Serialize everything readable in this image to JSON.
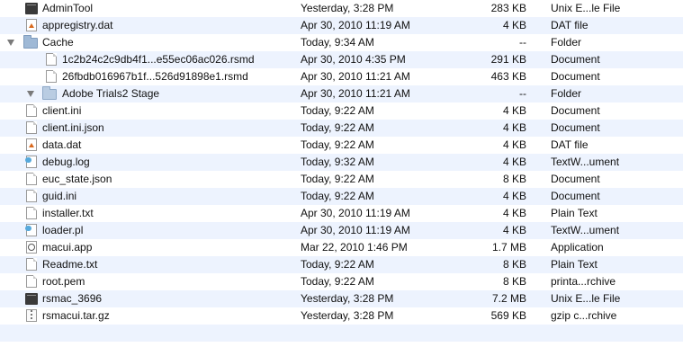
{
  "files": [
    {
      "name": "AdminTool",
      "date": "Yesterday, 3:28 PM",
      "size": "283 KB",
      "kind": "Unix E...le File",
      "icon": "exec-icon"
    },
    {
      "name": "appregistry.dat",
      "date": "Apr 30, 2010 11:19 AM",
      "size": "4 KB",
      "kind": "DAT file",
      "icon": "dat-icon"
    },
    {
      "name": "Cache",
      "date": "Today, 9:34 AM",
      "size": "--",
      "kind": "Folder",
      "icon": "folder-icon"
    },
    {
      "name": "1c2b24c2c9db4f1...e55ec06ac026.rsmd",
      "date": "Apr 30, 2010 4:35 PM",
      "size": "291 KB",
      "kind": "Document",
      "icon": "document-icon"
    },
    {
      "name": "26fbdb016967b1f...526d91898e1.rsmd",
      "date": "Apr 30, 2010 11:21 AM",
      "size": "463 KB",
      "kind": "Document",
      "icon": "document-icon"
    },
    {
      "name": "Adobe Trials2 Stage",
      "date": "Apr 30, 2010 11:21 AM",
      "size": "--",
      "kind": "Folder",
      "icon": "folder-icon"
    },
    {
      "name": "client.ini",
      "date": "Today, 9:22 AM",
      "size": "4 KB",
      "kind": "Document",
      "icon": "document-icon"
    },
    {
      "name": "client.ini.json",
      "date": "Today, 9:22 AM",
      "size": "4 KB",
      "kind": "Document",
      "icon": "document-icon"
    },
    {
      "name": "data.dat",
      "date": "Today, 9:22 AM",
      "size": "4 KB",
      "kind": "DAT file",
      "icon": "dat-icon"
    },
    {
      "name": "debug.log",
      "date": "Today, 9:32 AM",
      "size": "4 KB",
      "kind": "TextW...ument",
      "icon": "text-document-icon"
    },
    {
      "name": "euc_state.json",
      "date": "Today, 9:22 AM",
      "size": "8 KB",
      "kind": "Document",
      "icon": "document-icon"
    },
    {
      "name": "guid.ini",
      "date": "Today, 9:22 AM",
      "size": "4 KB",
      "kind": "Document",
      "icon": "document-icon"
    },
    {
      "name": "installer.txt",
      "date": "Apr 30, 2010 11:19 AM",
      "size": "4 KB",
      "kind": "Plain Text",
      "icon": "text-file-icon"
    },
    {
      "name": "loader.pl",
      "date": "Apr 30, 2010 11:19 AM",
      "size": "4 KB",
      "kind": "TextW...ument",
      "icon": "text-document-icon"
    },
    {
      "name": "macui.app",
      "date": "Mar 22, 2010 1:46 PM",
      "size": "1.7 MB",
      "kind": "Application",
      "icon": "application-icon"
    },
    {
      "name": "Readme.txt",
      "date": "Today, 9:22 AM",
      "size": "8 KB",
      "kind": "Plain Text",
      "icon": "text-file-icon"
    },
    {
      "name": "root.pem",
      "date": "Today, 9:22 AM",
      "size": "8 KB",
      "kind": "printa...rchive",
      "icon": "document-icon"
    },
    {
      "name": "rsmac_3696",
      "date": "Yesterday, 3:28 PM",
      "size": "7.2 MB",
      "kind": "Unix E...le File",
      "icon": "exec-icon"
    },
    {
      "name": "rsmacui.tar.gz",
      "date": "Yesterday, 3:28 PM",
      "size": "569 KB",
      "kind": "gzip c...rchive",
      "icon": "archive-icon"
    }
  ]
}
